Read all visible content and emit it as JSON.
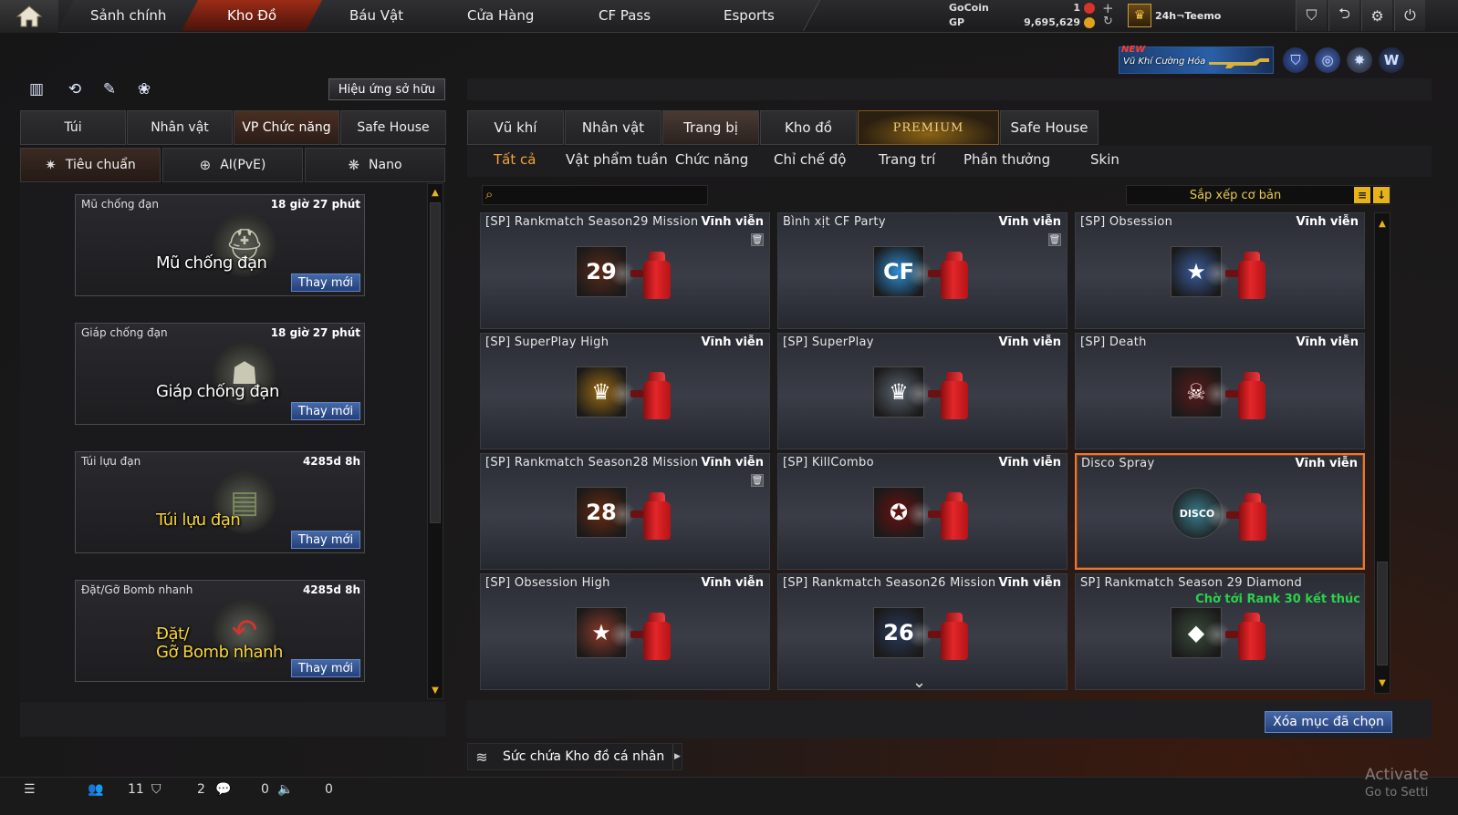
{
  "topbar": {
    "tabs": [
      {
        "label": "Sảnh chính",
        "active": false
      },
      {
        "label": "Kho Đồ",
        "active": true
      },
      {
        "label": "Báu Vật",
        "active": false
      },
      {
        "label": "Cửa Hàng",
        "active": false
      },
      {
        "label": "CF Pass",
        "active": false
      },
      {
        "label": "Esports",
        "active": false
      }
    ],
    "currency": {
      "gocoin_label": "GoCoin",
      "gocoin_value": "1",
      "gp_label": "GP",
      "gp_value": "9,695,629"
    },
    "user": {
      "name": "24h¬Teemo"
    }
  },
  "banner": {
    "new_label": "NEW",
    "title": "Vũ Khí Cường Hóa"
  },
  "left_panel": {
    "effects_button": "Hiệu ứng sở hữu",
    "tabs": [
      "Túi",
      "Nhân vật",
      "VP Chức năng",
      "Safe House"
    ],
    "active_tab": "VP Chức năng",
    "subtabs": [
      "Tiêu chuẩn",
      "AI(PvE)",
      "Nano"
    ],
    "active_subtab": "Tiêu chuẩn",
    "cards": [
      {
        "name": "Mũ chống đạn",
        "time": "18 giờ 27 phút",
        "caption": "Mũ chống đạn",
        "renew": "Thay mới",
        "icon": "helmet-icon"
      },
      {
        "name": "Giáp chống đạn",
        "time": "18 giờ 27 phút",
        "caption": "Giáp chống đạn",
        "renew": "Thay mới",
        "icon": "vest-icon"
      },
      {
        "name": "Túi lựu đạn",
        "time": "4285d 8h",
        "caption": "Túi lựu đạn",
        "renew": "Thay mới",
        "icon": "grenade-pouch-icon"
      },
      {
        "name": "Đặt/Gỡ Bomb nhanh",
        "time": "4285d 8h",
        "caption1": "Đặt/",
        "caption2": "Gỡ Bomb nhanh",
        "renew": "Thay mới",
        "icon": "bomb-kit-icon"
      }
    ]
  },
  "right_panel": {
    "tabs": [
      "Vũ khí",
      "Nhân vật",
      "Trang bị",
      "Kho đồ",
      "PREMIUM",
      "Safe House"
    ],
    "active_tab": "Trang bị",
    "filters": [
      "Tất cả",
      "Vật phẩm tuần",
      "Chức năng",
      "Chỉ chế độ",
      "Trang trí",
      "Phần thưởng",
      "Skin"
    ],
    "active_filter": "Tất cả",
    "search": {
      "placeholder": "",
      "value": ""
    },
    "sort_label": "Sắp xếp cơ bản",
    "items": [
      {
        "name": "[SP] Rankmatch Season29 Mission",
        "duration": "Vĩnh viễn",
        "trash": true,
        "emblem": "29",
        "emblem_color": "#5a2a1a"
      },
      {
        "name": "Bình xịt CF Party",
        "duration": "Vĩnh viễn",
        "trash": true,
        "emblem": "CF",
        "emblem_color": "#2d8fd6"
      },
      {
        "name": "[SP] Obsession",
        "duration": "Vĩnh viễn",
        "trash": false,
        "emblem": "★",
        "emblem_color": "#3b5b9a"
      },
      {
        "name": "[SP] SuperPlay High",
        "duration": "Vĩnh viễn",
        "trash": false,
        "emblem": "♛",
        "emblem_color": "#9a6a12"
      },
      {
        "name": "[SP] SuperPlay",
        "duration": "Vĩnh viễn",
        "trash": false,
        "emblem": "♛",
        "emblem_color": "#5b6470"
      },
      {
        "name": "[SP] Death",
        "duration": "Vĩnh viễn",
        "trash": false,
        "emblem": "☠",
        "emblem_color": "#5a1a1a"
      },
      {
        "name": "[SP] Rankmatch Season28 Mission",
        "duration": "Vĩnh viễn",
        "trash": true,
        "emblem": "28",
        "emblem_color": "#6a2a10"
      },
      {
        "name": "[SP] KillCombo",
        "duration": "Vĩnh viễn",
        "trash": false,
        "emblem": "✪",
        "emblem_color": "#6a1010"
      },
      {
        "name": "Disco Spray",
        "duration": "Vĩnh viễn",
        "trash": false,
        "emblem": "DISCO",
        "emblem_color": "#3a7a8a",
        "selected": true
      },
      {
        "name": "[SP] Obsession High",
        "duration": "Vĩnh viễn",
        "trash": false,
        "emblem": "★",
        "emblem_color": "#8a3a2a"
      },
      {
        "name": "[SP] Rankmatch Season26 Mission",
        "duration": "Vĩnh viễn",
        "trash": false,
        "emblem": "26",
        "emblem_color": "#2a3a5a"
      },
      {
        "name": "SP] Rankmatch Season 29 Diamond",
        "duration": "",
        "note": "Chờ tới Rank 30 kết thúc",
        "trash": false,
        "emblem": "◆",
        "emblem_color": "#3a4a3a"
      }
    ],
    "delete_button": "Xóa mục đã chọn",
    "capacity_label": "Sức chứa Kho đồ cá nhân"
  },
  "statusbar": {
    "friends": "11",
    "clan": "2",
    "messages": "0",
    "voice": "0"
  },
  "watermark": {
    "line1": "Activate",
    "line2": "Go to Setti"
  }
}
